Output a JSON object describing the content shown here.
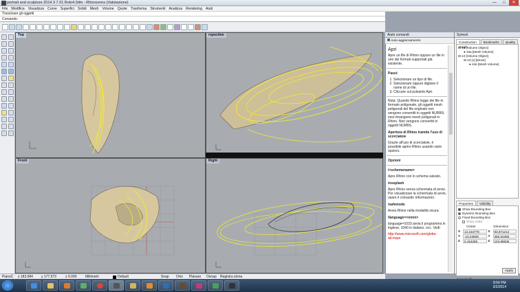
{
  "window": {
    "title": "portrait and sculpture 2014 3 7 01 Rolo4.3dm - Rhinoceros (Valutazione)",
    "controls": {
      "minimize": "—",
      "maximize": "□",
      "close": "✕"
    }
  },
  "menubar": [
    "File",
    "Modifica",
    "Visualizza",
    "Curve",
    "Superfici",
    "Solidi",
    "Mesh",
    "Volume",
    "Quote",
    "Trasforma",
    "Strumenti",
    "Analizza",
    "Rendering",
    "Aiuti"
  ],
  "command": {
    "history": "Trascinare gli oggetti",
    "prompt": "Comando:",
    "value": ""
  },
  "viewports": {
    "top": "Top",
    "perspective": "rspective",
    "front": "Front",
    "right": "Right"
  },
  "statusbar": {
    "plane": "PianoC",
    "x": "x 183.584",
    "y": "y 177.973",
    "z": "z 0.000",
    "units": "Millimetri",
    "layer": "Default",
    "snap": "Snap",
    "ortho": "Orto",
    "planar": "Planare",
    "osnap": "Osnap",
    "record": "Registra storia"
  },
  "help": {
    "panel_title": "Aiuto comandi",
    "auto_update": "Auto-aggiornamento",
    "heading": "Apri",
    "intro": "Apre un file di Rhino oppure un file in uno dei formati supportati già esistente.",
    "steps_title": "Passi:",
    "steps": [
      "Selezionare un tipo di file.",
      "Selezionare oppure digitare il nome di un file.",
      "Cliccare sul pulsante Apri."
    ],
    "note": "Nota: Quando Rhino legge dei file in formato poligonale, gli oggetti mesh poligonali del file originale non vengono convertiti in oggetti NURBS: essi rimangono mesh poligonali in Rhino. Non vengono convertiti in oggetti NURBS.",
    "script_title": "Apertura di Rhino tramite l'uso di scorciatoie",
    "script_text": "Grazie all'uso di scorciatoie, è possibile aprire Rhino usando varie opzioni.",
    "options_title": "Opzioni",
    "opt1_title": "/<schemename>",
    "opt1_text": "Apre Rhino con lo schema salvato.",
    "opt2_title": "/nosplash",
    "opt2_text": "Apre Rhino senza schermata di avvio. Per visualizzare la schermata di avvio, usare il comando Informazioni.",
    "opt3_title": "/safemode",
    "opt3_text": "Avvia Rhino nella modalità sicura.",
    "opt4_title": "/language=<nnnn>",
    "opt4_text": "language=1033 avvia il programma in inglese, 1040 in italiano, ecc. Vedi:",
    "opt4_link": "http://www.microsoft.com/globa-all.mspx"
  },
  "panel": {
    "title": "Symvol",
    "tabs": [
      "Construction Graph",
      "Bookmarks",
      "Quality"
    ],
    "tree": [
      "43 [Volume Object]",
      "43a [Mesh Volume]",
      "44 [Volume Object]",
      "43 [1] [Move]",
      "44e [Mesh Volume]"
    ],
    "prop_tabs": [
      "Properties",
      "Visibility"
    ],
    "show_bbox": "Show Bounding Box",
    "dynamic_bbox": "Dynamic Bounding Box",
    "fixed_bbox": "Fixed Bounding Box",
    "show_solid": "Show Solid",
    "center": "Center",
    "dimension": "Dimension",
    "cx": "14.154778",
    "cy": "-16.23809",
    "cz": "5.154286",
    "dx": "93.871214",
    "dy": "385.52385",
    "dz": "104.89606",
    "footer": "Symvol idle.",
    "apply": "Apply"
  },
  "clock": {
    "time": "8:54 PM",
    "date": "3/2/2014"
  },
  "colors": {
    "selection": "#f2ea2e",
    "model": "#d9c9a2",
    "grid": "#8e9296"
  }
}
